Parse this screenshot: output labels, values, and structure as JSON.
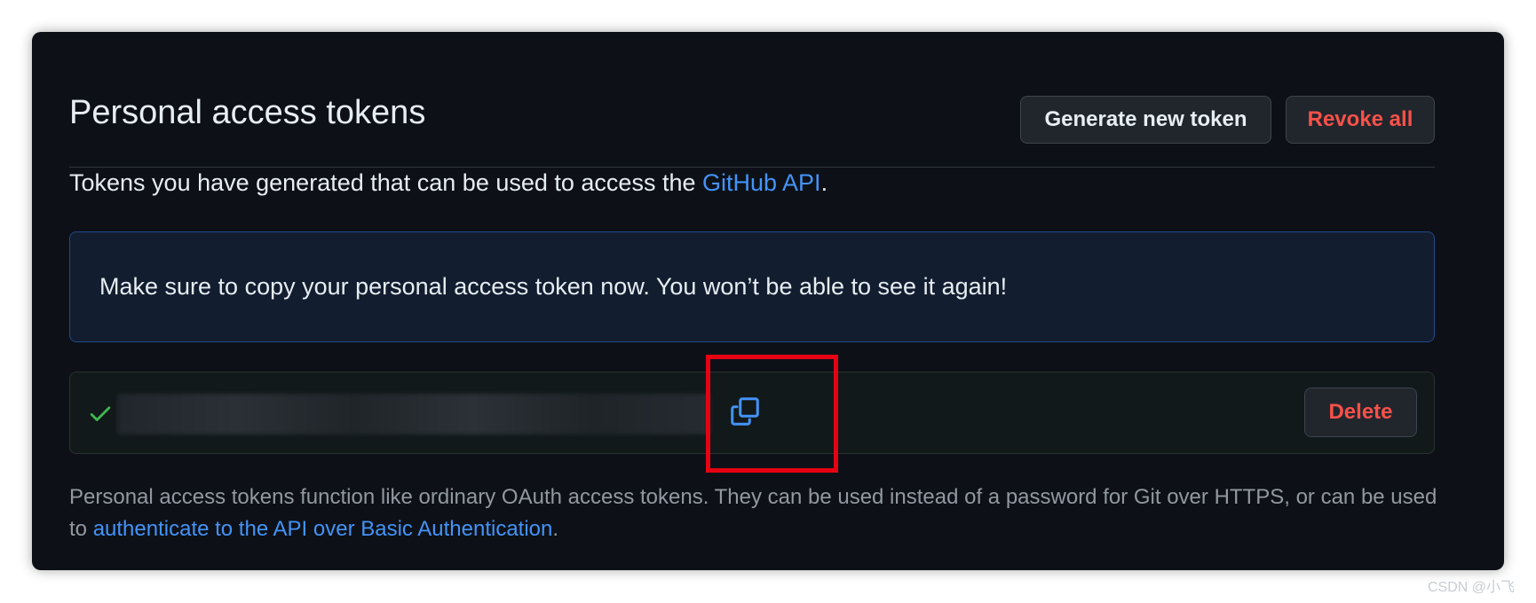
{
  "header": {
    "title": "Personal access tokens",
    "generate_button": "Generate new token",
    "revoke_button": "Revoke all"
  },
  "description": {
    "prefix": "Tokens you have generated that can be used to access the ",
    "link_text": "GitHub API",
    "suffix": "."
  },
  "flash": {
    "message": "Make sure to copy your personal access token now. You won’t be able to see it again!"
  },
  "token": {
    "value": "",
    "status_icon": "check-icon",
    "copy_icon": "copy-icon",
    "delete_button": "Delete"
  },
  "note": {
    "text": "Personal access tokens function like ordinary OAuth access tokens. They can be used instead of a password for Git over HTTPS, or can be used to ",
    "link_text": "authenticate to the API over Basic Authentication",
    "suffix": "."
  },
  "watermark": "CSDN @小飞",
  "colors": {
    "background": "#0d1117",
    "text": "#e6edf3",
    "link": "#4493f8",
    "danger": "#f85149",
    "success": "#3fb950",
    "flash_bg": "#121d2f",
    "flash_border": "#1f4a8a",
    "highlight": "#e60012"
  }
}
